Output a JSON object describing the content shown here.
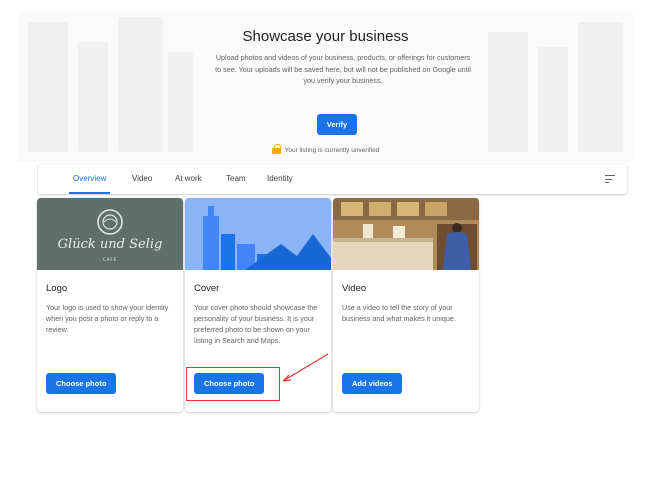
{
  "hero": {
    "title": "Showcase your business",
    "description": "Upload photos and videos of your business, products, or offerings for customers to see. Your uploads will be saved here, but will not be published on Google until you verify your business.",
    "verify_label": "Verify",
    "status_text": "Your listing is currently unverified"
  },
  "tabs": [
    {
      "label": "Overview",
      "active": true
    },
    {
      "label": "Video",
      "active": false
    },
    {
      "label": "At work",
      "active": false
    },
    {
      "label": "Team",
      "active": false
    },
    {
      "label": "Identity",
      "active": false
    }
  ],
  "cards": [
    {
      "title": "Logo",
      "description": "Your logo is used to show your identity when you post a photo or reply to a review.",
      "button_label": "Choose photo",
      "logo_text": "Glück und Selig",
      "logo_subtext": "CAFE"
    },
    {
      "title": "Cover",
      "description": "Your cover photo should showcase the personality of your business. It is your preferred photo to be shown on your listing in Search and Maps.",
      "button_label": "Choose photo"
    },
    {
      "title": "Video",
      "description": "Use a video to tell the story of your business and what makes it unique.",
      "button_label": "Add videos"
    }
  ],
  "colors": {
    "accent": "#1a73e8",
    "annotation": "#e53935",
    "warning": "#f9ab00"
  },
  "icons": {
    "lock": "lock-icon",
    "sort": "sort-icon"
  }
}
